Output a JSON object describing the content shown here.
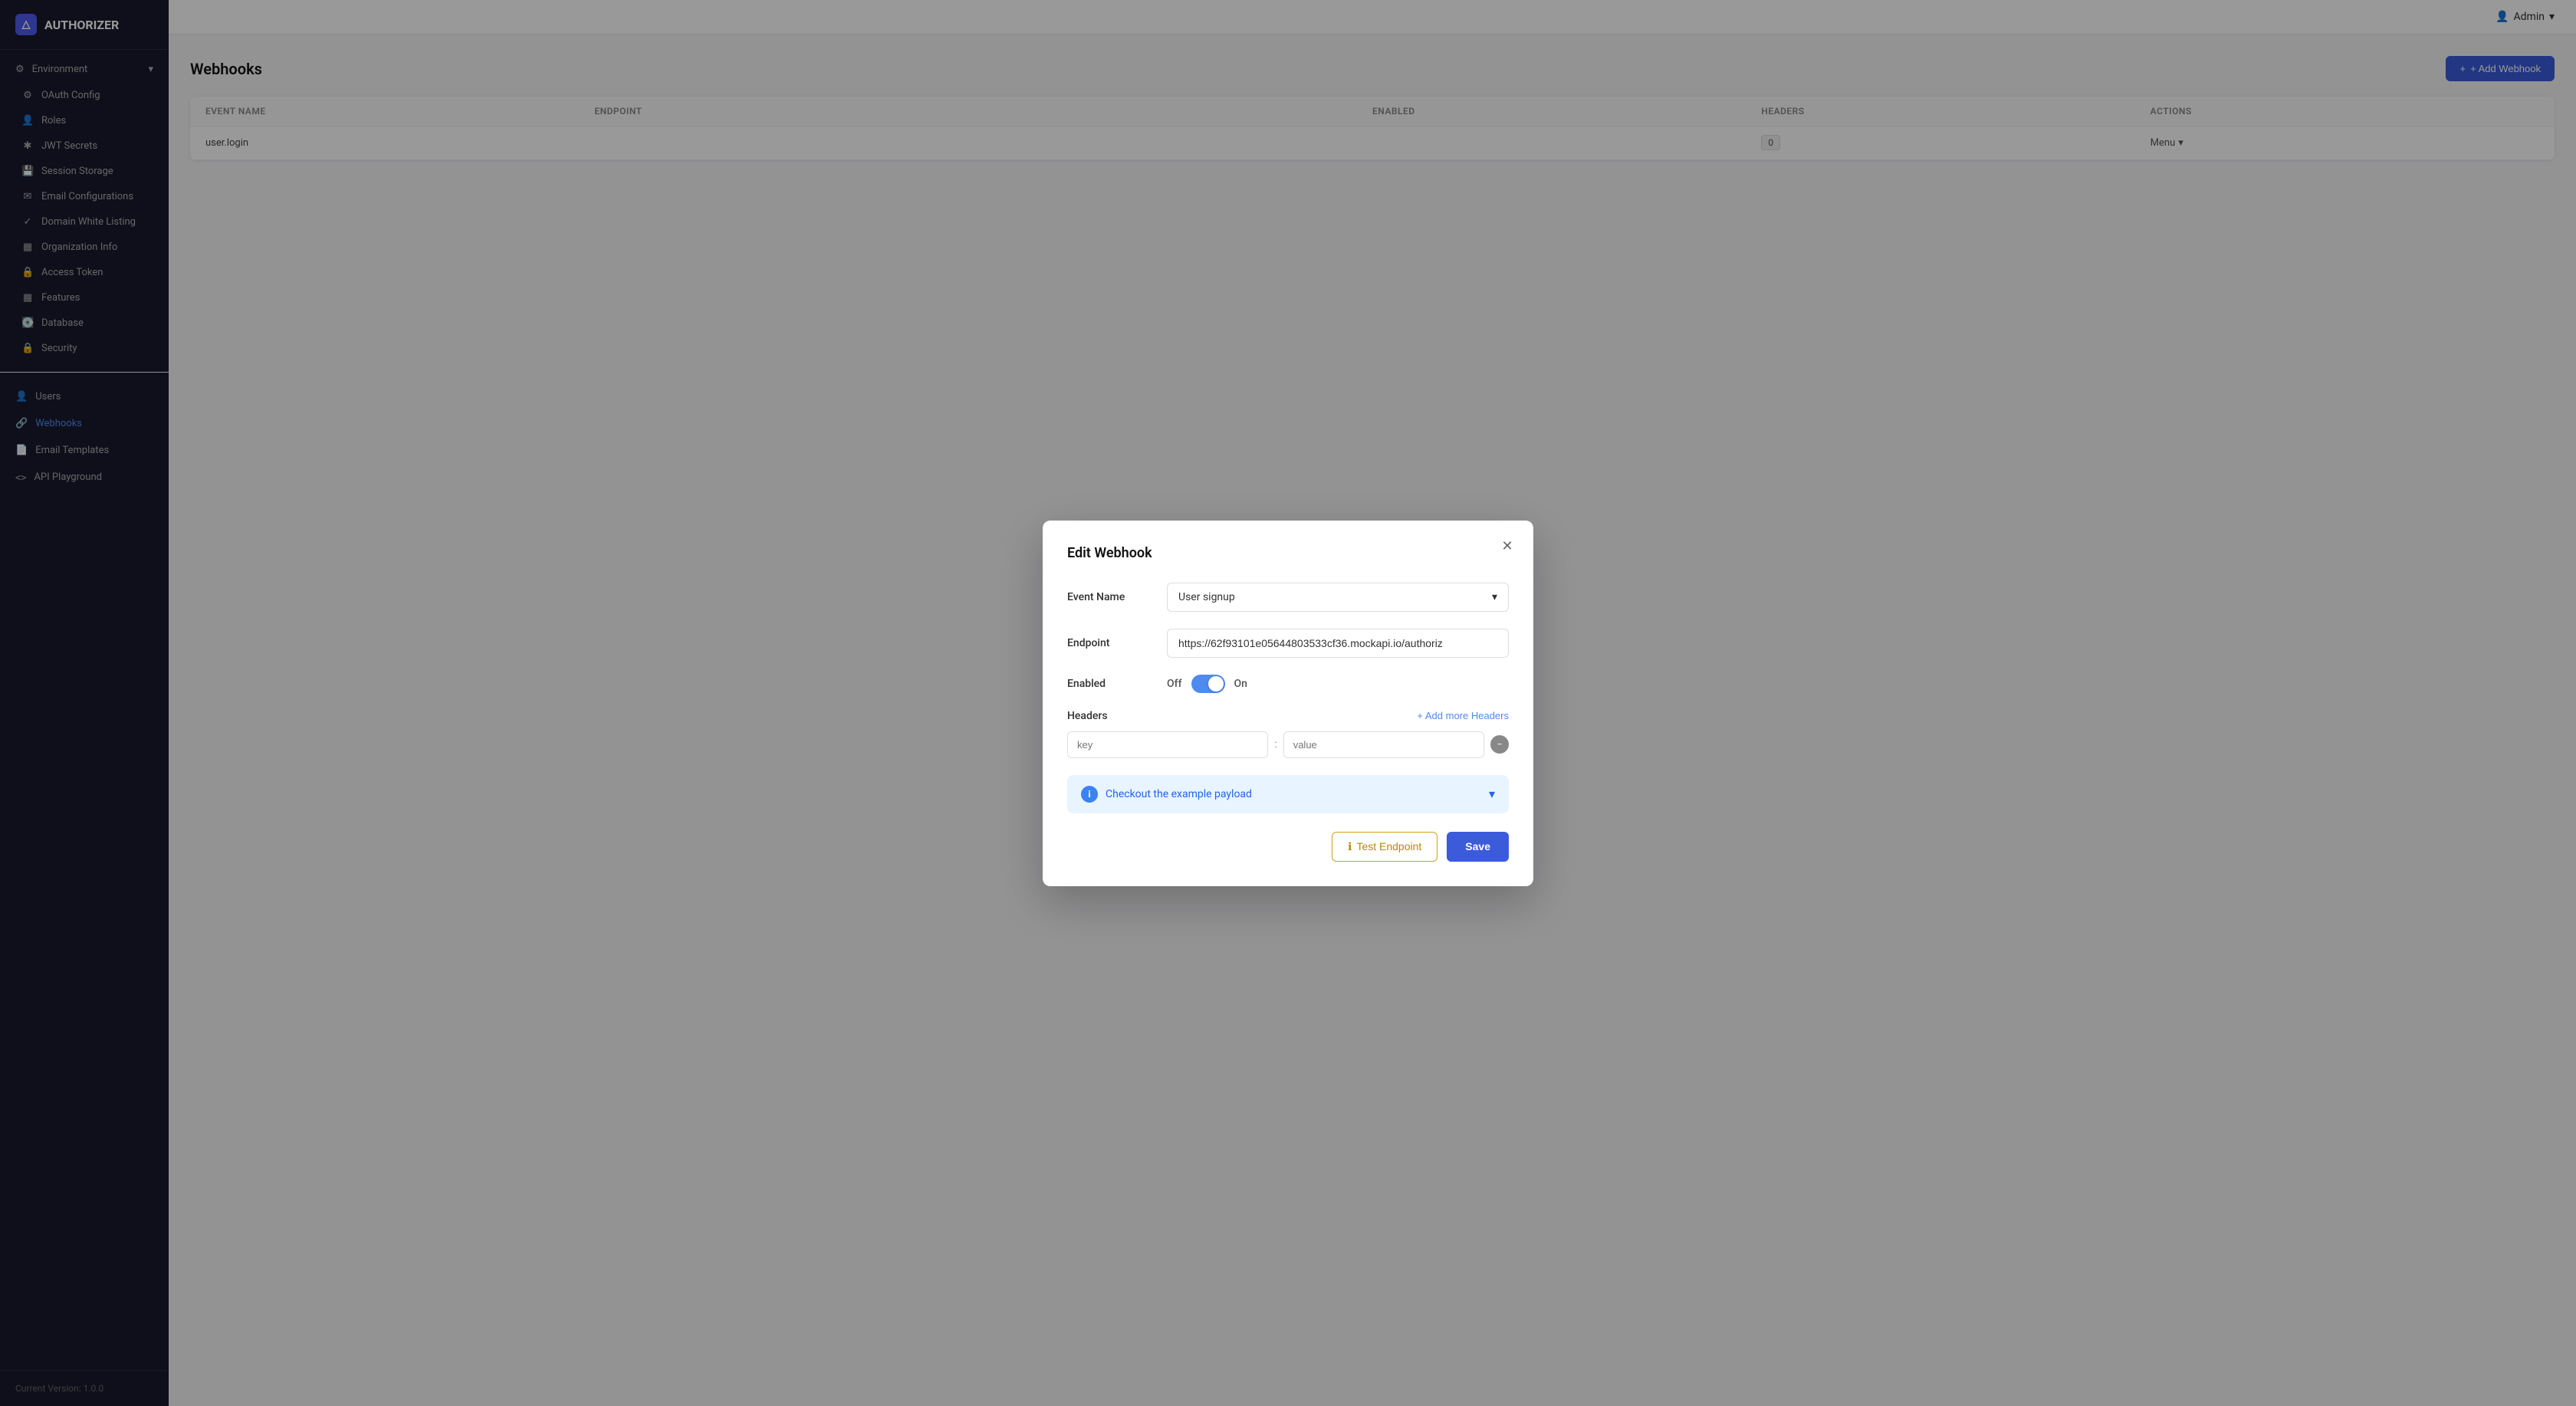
{
  "app": {
    "name": "AUTHORIZER",
    "version_label": "Current Version: 1.0.0"
  },
  "topbar": {
    "admin_label": "Admin",
    "chevron": "▾"
  },
  "sidebar": {
    "environment_label": "Environment",
    "items": [
      {
        "id": "oauth-config",
        "label": "OAuth Config",
        "icon": "⚙"
      },
      {
        "id": "roles",
        "label": "Roles",
        "icon": "👤"
      },
      {
        "id": "jwt-secrets",
        "label": "JWT Secrets",
        "icon": "✱"
      },
      {
        "id": "session-storage",
        "label": "Session Storage",
        "icon": "💾"
      },
      {
        "id": "email-configurations",
        "label": "Email Configurations",
        "icon": "✉"
      },
      {
        "id": "domain-white-listing",
        "label": "Domain White Listing",
        "icon": "✓"
      },
      {
        "id": "organization-info",
        "label": "Organization Info",
        "icon": "▦"
      },
      {
        "id": "access-token",
        "label": "Access Token",
        "icon": "🔒"
      },
      {
        "id": "features",
        "label": "Features",
        "icon": "▦"
      },
      {
        "id": "database",
        "label": "Database",
        "icon": "💽"
      },
      {
        "id": "security",
        "label": "Security",
        "icon": "🔒"
      }
    ],
    "main_items": [
      {
        "id": "users",
        "label": "Users",
        "icon": "👤"
      },
      {
        "id": "webhooks",
        "label": "Webhooks",
        "icon": "🔗",
        "active": true
      },
      {
        "id": "email-templates",
        "label": "Email Templates",
        "icon": "📄"
      },
      {
        "id": "api-playground",
        "label": "API Playground",
        "icon": "<>"
      }
    ]
  },
  "content": {
    "page_title": "Webhooks",
    "add_button": "+ Add Webhook",
    "table": {
      "columns": [
        "EVENT NAME",
        "ENDPOINT",
        "ENABLED",
        "HEADERS",
        "ACTIONS"
      ],
      "rows": [
        {
          "event_name": "user.login",
          "endpoint": "",
          "enabled": "",
          "headers_count": "0",
          "actions": "Menu"
        }
      ]
    }
  },
  "modal": {
    "title": "Edit Webhook",
    "close_icon": "✕",
    "fields": {
      "event_name_label": "Event Name",
      "event_name_value": "User signup",
      "event_name_placeholder": "User signup",
      "endpoint_label": "Endpoint",
      "endpoint_value": "https://62f93101e05644803533cf36.mockapi.io/authoriz",
      "endpoint_placeholder": "https://62f93101e05644803533cf36.mockapi.io/authoriz",
      "enabled_label": "Enabled",
      "enabled_off": "Off",
      "enabled_on": "On",
      "headers_label": "Headers",
      "add_more_headers": "+ Add more Headers",
      "key_placeholder": "key",
      "value_placeholder": "value"
    },
    "payload": {
      "text": "Checkout the example payload",
      "chevron": "▾"
    },
    "actions": {
      "test_endpoint": "Test Endpoint",
      "save": "Save"
    }
  }
}
